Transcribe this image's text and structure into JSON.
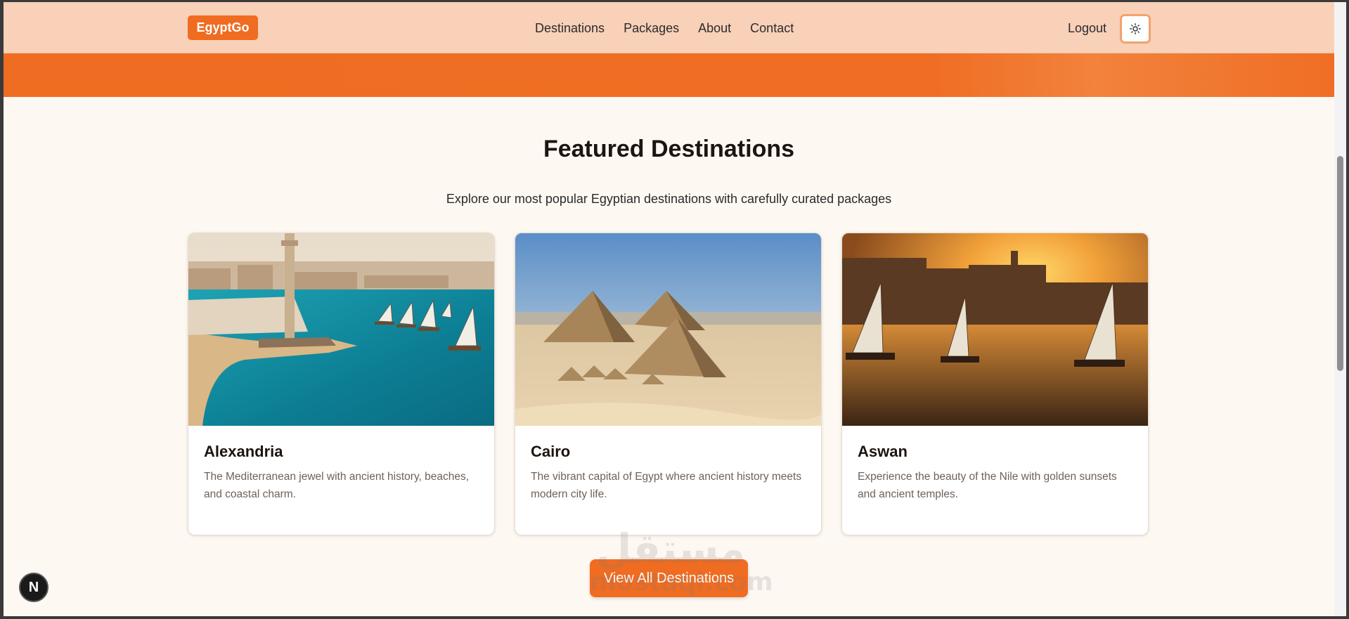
{
  "navbar": {
    "logo": "EgyptGo",
    "links": [
      "Destinations",
      "Packages",
      "About",
      "Contact"
    ],
    "logout": "Logout",
    "theme_icon": "sun-icon"
  },
  "section": {
    "title": "Featured Destinations",
    "subtitle": "Explore our most popular Egyptian destinations with carefully curated packages"
  },
  "cards": [
    {
      "title": "Alexandria",
      "description": "The Mediterranean jewel with ancient history, beaches, and coastal charm."
    },
    {
      "title": "Cairo",
      "description": "The vibrant capital of Egypt where ancient history meets modern city life."
    },
    {
      "title": "Aswan",
      "description": "Experience the beauty of the Nile with golden sunsets and ancient temples."
    }
  ],
  "cta": {
    "label": "View All Destinations"
  },
  "watermark": {
    "arabic": "مستقل",
    "latin": "mostaql.com"
  },
  "dev_badge": {
    "letter": "N"
  },
  "colors": {
    "accent": "#ef6c21",
    "nav_bg": "#f9d0b8",
    "page_bg": "#fef8f2"
  }
}
